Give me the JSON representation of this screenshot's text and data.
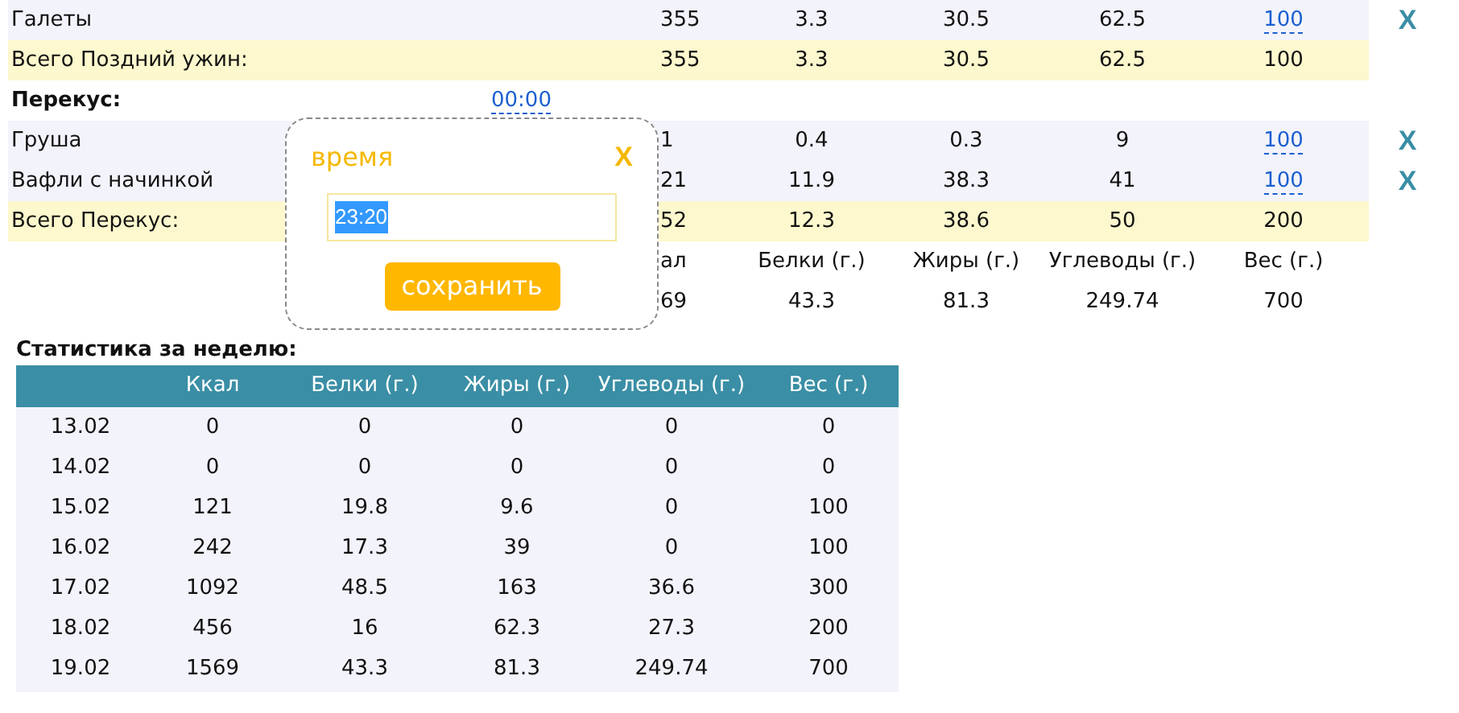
{
  "meal_rows": [
    {
      "kind": "item",
      "name": "Галеты",
      "kcal": "355",
      "protein": "3.3",
      "fat": "30.5",
      "carbs": "62.5",
      "weight": "100",
      "delete": "X"
    },
    {
      "kind": "total",
      "name": "Всего Поздний ужин:",
      "kcal": "355",
      "protein": "3.3",
      "fat": "30.5",
      "carbs": "62.5",
      "weight": "100"
    },
    {
      "kind": "meal",
      "name": "Перекус:",
      "time": "00:00"
    },
    {
      "kind": "item",
      "name": "Груша",
      "kcal": "1",
      "protein": "0.4",
      "fat": "0.3",
      "carbs": "9",
      "weight": "100",
      "delete": "X"
    },
    {
      "kind": "item",
      "name": "Вафли с начинкой",
      "kcal": "21",
      "protein": "11.9",
      "fat": "38.3",
      "carbs": "41",
      "weight": "100",
      "delete": "X"
    },
    {
      "kind": "total",
      "name": "Всего Перекус:",
      "kcal": "52",
      "protein": "12.3",
      "fat": "38.6",
      "carbs": "50",
      "weight": "200"
    }
  ],
  "summary": {
    "columns": [
      "ал",
      "Белки (г.)",
      "Жиры (г.)",
      "Углеводы (г.)",
      "Вес (г.)"
    ],
    "values": [
      "69",
      "43.3",
      "81.3",
      "249.74",
      "700"
    ]
  },
  "popup": {
    "title": "время",
    "close": "X",
    "value": "23:20",
    "save_button": "сохранить"
  },
  "weekly": {
    "title": "Статистика за неделю:",
    "columns": [
      "Ккал",
      "Белки (г.)",
      "Жиры (г.)",
      "Углеводы (г.)",
      "Вес (г.)"
    ],
    "rows": [
      {
        "date": "13.02",
        "values": [
          "0",
          "0",
          "0",
          "0",
          "0"
        ]
      },
      {
        "date": "14.02",
        "values": [
          "0",
          "0",
          "0",
          "0",
          "0"
        ]
      },
      {
        "date": "15.02",
        "values": [
          "121",
          "19.8",
          "9.6",
          "0",
          "100"
        ]
      },
      {
        "date": "16.02",
        "values": [
          "242",
          "17.3",
          "39",
          "0",
          "100"
        ]
      },
      {
        "date": "17.02",
        "values": [
          "1092",
          "48.5",
          "163",
          "36.6",
          "300"
        ]
      },
      {
        "date": "18.02",
        "values": [
          "456",
          "16",
          "62.3",
          "27.3",
          "200"
        ]
      },
      {
        "date": "19.02",
        "values": [
          "1569",
          "43.3",
          "81.3",
          "249.74",
          "700"
        ]
      }
    ]
  }
}
